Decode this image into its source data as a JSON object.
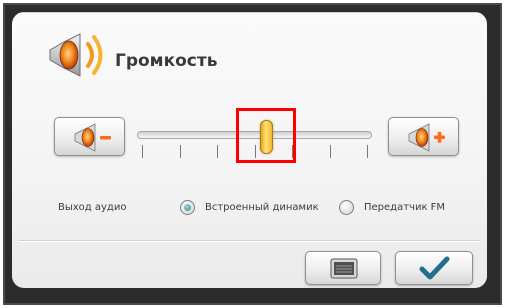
{
  "dialog": {
    "title": "Громкость",
    "title_icon": "speaker-volume-icon"
  },
  "volume": {
    "decrease_icon": "speaker-minus-icon",
    "increase_icon": "speaker-plus-icon",
    "slider_level": 0.55,
    "tick_count": 7,
    "thumb_color": "#f0b72a",
    "highlight_color": "#ff0000"
  },
  "audio_output": {
    "label": "Выход аудио",
    "options": [
      {
        "label": "Встроенный динамик",
        "selected": true
      },
      {
        "label": "Передатчик FM",
        "selected": false
      }
    ]
  },
  "footer": {
    "radio_button_icon": "radio-icon",
    "ok_icon": "checkmark-icon",
    "ok_color": "#1f6f8f"
  }
}
